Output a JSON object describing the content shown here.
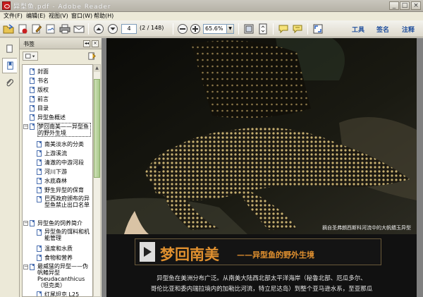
{
  "window": {
    "title": "异型鱼.pdf - Adobe Reader",
    "min": "_",
    "max": "□",
    "close": "×"
  },
  "menu": [
    "文件(F)",
    "编辑(E)",
    "视图(V)",
    "窗口(W)",
    "帮助(H)"
  ],
  "toolbar": {
    "page_current": "4",
    "page_total": "(2 / 148)",
    "zoom": "65.6%",
    "links": [
      "工具",
      "签名",
      "注释"
    ]
  },
  "panel": {
    "title": "书签",
    "bookmarks": [
      {
        "label": "封面",
        "level": 1
      },
      {
        "label": "书名",
        "level": 1
      },
      {
        "label": "版权",
        "level": 1
      },
      {
        "label": "前言",
        "level": 1
      },
      {
        "label": "目录",
        "level": 1
      },
      {
        "label": "异型鱼概述",
        "level": 1
      },
      {
        "label": "梦回南美——异型鱼的野外生境",
        "level": 1,
        "expanded": true,
        "selected": true
      },
      {
        "label": "南美淡水的分类",
        "level": 2
      },
      {
        "label": "上游溪流",
        "level": 2
      },
      {
        "label": "清澈的中游河段",
        "level": 2
      },
      {
        "label": "河川下游",
        "level": 2
      },
      {
        "label": "水底森林",
        "level": 2
      },
      {
        "label": "野生异型的保育",
        "level": 2
      },
      {
        "label": "巴西政府颁布的异型鱼禁止出口名单",
        "level": 2
      },
      {
        "label": "异型鱼的饲养简介",
        "level": 1,
        "expanded": true
      },
      {
        "label": "异型鱼的饵料和机能管理",
        "level": 2
      },
      {
        "label": "温度和水质",
        "level": 2
      },
      {
        "label": "食物和营养",
        "level": 2
      },
      {
        "label": "最威猛的异型——伪帆鳍异型 Pseudacanthicus（坦克类）",
        "level": 1,
        "expanded": true
      },
      {
        "label": "红尾坦克 L25",
        "level": 2
      }
    ]
  },
  "document": {
    "photo_caption": "摘自圣弗朗西斯科河流中的大帆鳍玉异型",
    "heading": "梦回南美",
    "subheading": "——异型鱼的野外生境",
    "paragraph_lines": [
      "异型鱼在美洲分布广泛。从南美大陆西北部太平洋海岸（秘鲁北部、厄瓜多尔、",
      "哥伦比亚和委内瑞拉境内的加勒比河流，特立尼达岛）到整个亚马逊水系，至亚那瓜"
    ]
  }
}
